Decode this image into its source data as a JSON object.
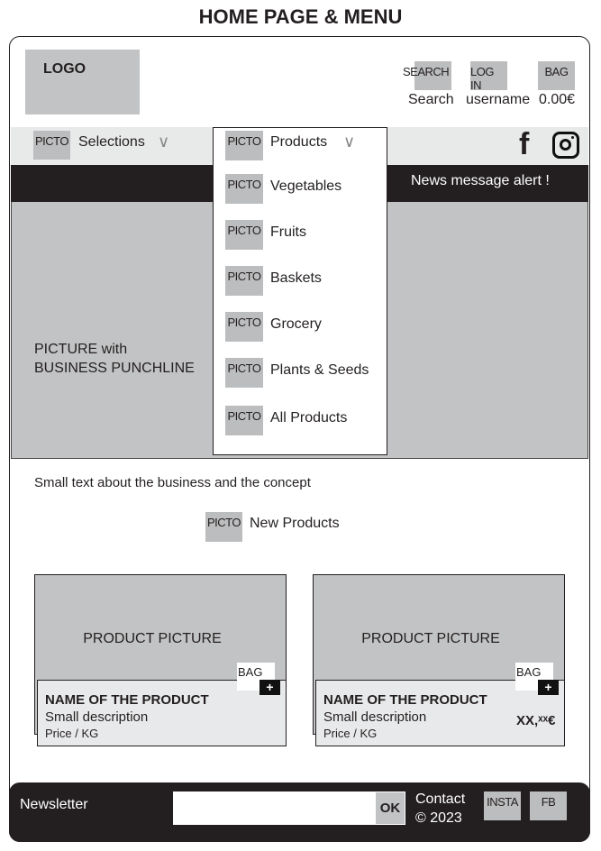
{
  "page_title": "HOME PAGE & MENU",
  "header": {
    "logo": "LOGO",
    "search_icon": "SEARCH",
    "search_label": "Search",
    "login_icon": "LOG IN",
    "login_label": "username",
    "bag_icon": "BAG",
    "bag_label": "0.00€"
  },
  "nav": {
    "picto": "PICTO",
    "selections": "Selections",
    "products": "Products"
  },
  "dropdown": [
    {
      "picto": "PICTO",
      "label": "Vegetables"
    },
    {
      "picto": "PICTO",
      "label": "Fruits"
    },
    {
      "picto": "PICTO",
      "label": "Baskets"
    },
    {
      "picto": "PICTO",
      "label": "Grocery"
    },
    {
      "picto": "PICTO",
      "label": "Plants & Seeds"
    },
    {
      "picto": "PICTO",
      "label": "All Products"
    }
  ],
  "news": "News message alert !",
  "hero": {
    "line1": "PICTURE with",
    "line2": "BUSINESS PUNCHLINE"
  },
  "intro": "Small text about the business and the concept",
  "new_products": {
    "picto": "PICTO",
    "label": "New Products"
  },
  "products": [
    {
      "picture": "PRODUCT PICTURE",
      "bag": "BAG",
      "plus": "+",
      "name": "NAME OF THE PRODUCT",
      "desc": "Small description",
      "unit": "Price / KG",
      "price": ""
    },
    {
      "picture": "PRODUCT PICTURE",
      "bag": "BAG",
      "plus": "+",
      "name": "NAME OF THE PRODUCT",
      "desc": "Small description",
      "unit": "Price / KG",
      "price": "XX,ˣˣ€"
    }
  ],
  "footer": {
    "newsletter": "Newsletter",
    "input_value": "",
    "ok": "OK",
    "contact": "Contact",
    "copyright": "© 2023",
    "insta": "INSTA",
    "fb": "FB"
  }
}
